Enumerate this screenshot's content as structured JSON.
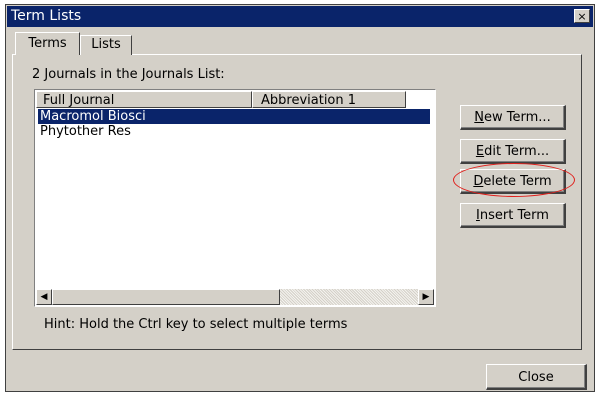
{
  "window": {
    "title": "Term Lists",
    "close_glyph": "×"
  },
  "tabs": [
    {
      "label": "Terms",
      "active": true
    },
    {
      "label": "Lists",
      "active": false
    }
  ],
  "terms_panel": {
    "count_label": "2 Journals in the Journals List:",
    "columns": [
      "Full Journal",
      "Abbreviation 1"
    ],
    "rows": [
      {
        "full_journal": "Macromol Biosci",
        "abbreviation_1": "",
        "selected": true
      },
      {
        "full_journal": "Phytother Res",
        "abbreviation_1": "",
        "selected": false
      }
    ],
    "hint": "Hint: Hold the Ctrl key to select multiple terms"
  },
  "buttons": {
    "new_term": {
      "accel": "N",
      "rest": "ew Term..."
    },
    "edit_term": {
      "accel": "E",
      "rest": "dit Term..."
    },
    "delete_term": {
      "accel": "D",
      "rest": "elete Term"
    },
    "insert_term": {
      "accel": "I",
      "rest": "nsert Term"
    },
    "close": "Close"
  },
  "colors": {
    "title_bar": "#0a246a",
    "selection": "#0a246a",
    "face": "#d4d0c8",
    "annotation_ellipse": "#e0201c"
  },
  "icons": {
    "scroll_left": "◀",
    "scroll_right": "▶"
  }
}
